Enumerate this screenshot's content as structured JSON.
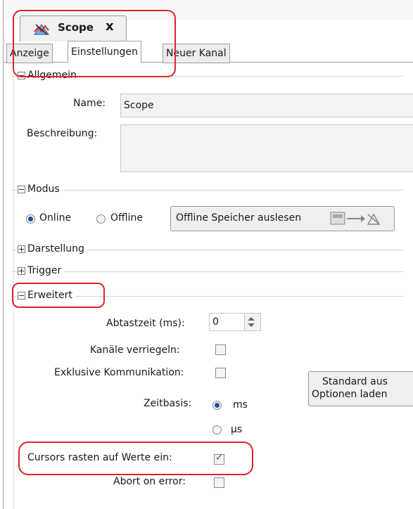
{
  "document_tab": {
    "title": "Scope",
    "close": "x",
    "icon": "scope-icon"
  },
  "tabs": [
    {
      "label": "Anzeige",
      "active": false
    },
    {
      "label": "Einstellungen",
      "active": true
    },
    {
      "label": "Neuer Kanal",
      "active": false
    }
  ],
  "allgemein": {
    "title": "Allgemein",
    "name_label": "Name:",
    "name_value": "Scope",
    "beschreibung_label": "Beschreibung:",
    "beschreibung_value": ""
  },
  "modus": {
    "title": "Modus",
    "online_label": "Online",
    "offline_label": "Offline",
    "selected": "Online",
    "offline_read_button": "Offline Speicher auslesen"
  },
  "darstellung": {
    "title": "Darstellung",
    "expanded": false
  },
  "trigger": {
    "title": "Trigger",
    "expanded": false
  },
  "erweitert": {
    "title": "Erweitert",
    "abtastzeit_label": "Abtastzeit (ms):",
    "abtastzeit_value": "0",
    "kanaele_label": "Kanäle verriegeln:",
    "kanaele_checked": false,
    "exklusiv_label": "Exklusive Kommunikation:",
    "exklusiv_checked": false,
    "zeitbasis_label": "Zeitbasis:",
    "zeitbasis_ms": "ms",
    "zeitbasis_us": "µs",
    "zeitbasis_selected": "ms",
    "cursors_label": "Cursors rasten auf Werte ein:",
    "cursors_checked": true,
    "abort_label": "Abort on error:",
    "abort_checked": false,
    "standard_button_line1": "Standard aus",
    "standard_button_line2": "Optionen laden"
  },
  "colors": {
    "highlight": "#e0242a",
    "selection": "#1f4f9e"
  }
}
